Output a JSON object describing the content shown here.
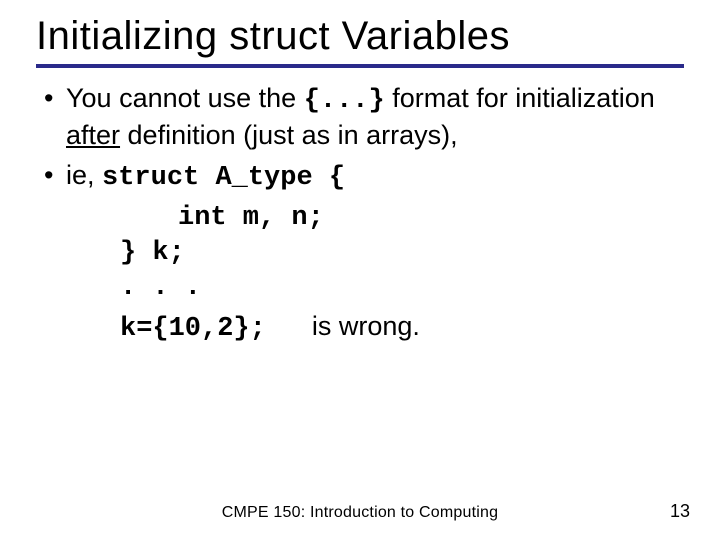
{
  "title": "Initializing struct Variables",
  "bullet1": {
    "marker": "•",
    "pre": "You cannot use the ",
    "code": "{...}",
    "mid": " format for initialization ",
    "underlined": "after",
    "post": " definition (just as in arrays),"
  },
  "bullet2": {
    "marker": "•",
    "pre": "ie, ",
    "code_a": "struct A_type {",
    "code_b": "int m, n;",
    "code_c": "} k;",
    "ellipsis": ". . .",
    "final_code": "k={10,2};",
    "final_text": "is wrong."
  },
  "footer": {
    "course": "CMPE 150: Introduction to Computing",
    "page": "13"
  }
}
